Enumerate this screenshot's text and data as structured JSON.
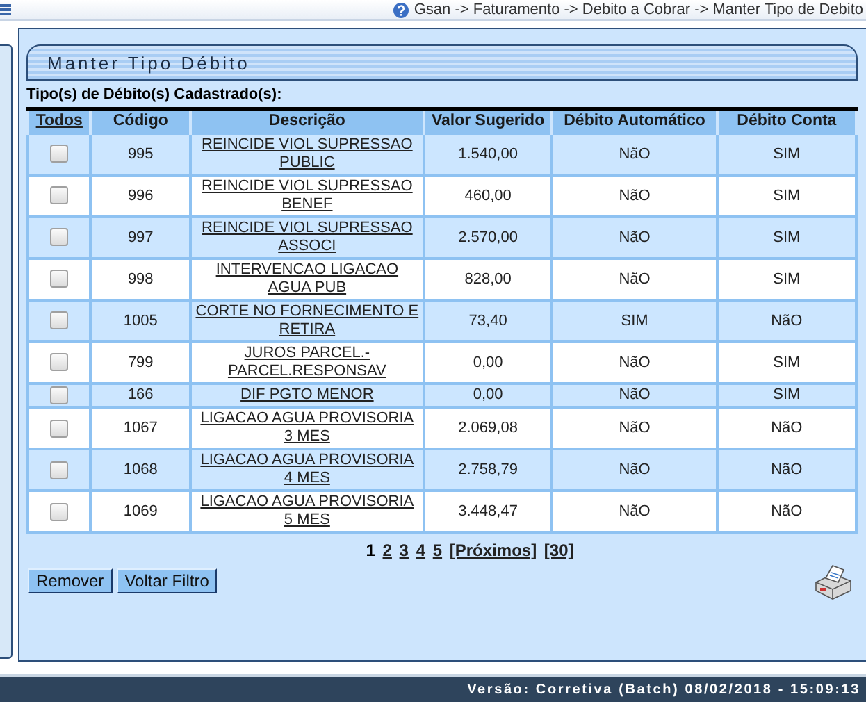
{
  "breadcrumb": "Gsan -> Faturamento -> Debito a Cobrar -> Manter Tipo de Debito",
  "panel": {
    "title": "Manter Tipo Débito",
    "caption": "Tipo(s) de Débito(s) Cadastrado(s):"
  },
  "table": {
    "columns": [
      "Todos",
      "Código",
      "Descrição",
      "Valor Sugerido",
      "Débito Automático",
      "Débito Conta"
    ],
    "rows": [
      {
        "checked": false,
        "code": "995",
        "description": "REINCIDE VIOL SUPRESSAO PUBLIC",
        "value": "1.540,00",
        "automatic": "NãO",
        "account": "SIM"
      },
      {
        "checked": false,
        "code": "996",
        "description": "REINCIDE VIOL SUPRESSAO BENEF",
        "value": "460,00",
        "automatic": "NãO",
        "account": "SIM"
      },
      {
        "checked": false,
        "code": "997",
        "description": "REINCIDE VIOL SUPRESSAO ASSOCI",
        "value": "2.570,00",
        "automatic": "NãO",
        "account": "SIM"
      },
      {
        "checked": false,
        "code": "998",
        "description": "INTERVENCAO LIGACAO AGUA PUB",
        "value": "828,00",
        "automatic": "NãO",
        "account": "SIM"
      },
      {
        "checked": false,
        "code": "1005",
        "description": "CORTE NO FORNECIMENTO E RETIRA",
        "value": "73,40",
        "automatic": "SIM",
        "account": "NãO"
      },
      {
        "checked": false,
        "code": "799",
        "description": "JUROS PARCEL.- PARCEL.RESPONSAV",
        "value": "0,00",
        "automatic": "NãO",
        "account": "SIM"
      },
      {
        "checked": false,
        "code": "166",
        "description": "DIF PGTO MENOR",
        "value": "0,00",
        "automatic": "NãO",
        "account": "SIM"
      },
      {
        "checked": false,
        "code": "1067",
        "description": "LIGACAO AGUA PROVISORIA 3 MES",
        "value": "2.069,08",
        "automatic": "NãO",
        "account": "NãO"
      },
      {
        "checked": false,
        "code": "1068",
        "description": "LIGACAO AGUA PROVISORIA 4 MES",
        "value": "2.758,79",
        "automatic": "NãO",
        "account": "NãO"
      },
      {
        "checked": false,
        "code": "1069",
        "description": "LIGACAO AGUA PROVISORIA 5 MES",
        "value": "3.448,47",
        "automatic": "NãO",
        "account": "NãO"
      }
    ]
  },
  "pagination": {
    "pages": [
      {
        "label": "1",
        "selected": true
      },
      {
        "label": "2",
        "selected": false
      },
      {
        "label": "3",
        "selected": false
      },
      {
        "label": "4",
        "selected": false
      },
      {
        "label": "5",
        "selected": false
      }
    ],
    "next": "[Próximos]",
    "last": "[30]"
  },
  "buttons": [
    "Remover",
    "Voltar Filtro"
  ],
  "footer": "Versão: Corretiva (Batch) 08/02/2018 - 15:09:13"
}
